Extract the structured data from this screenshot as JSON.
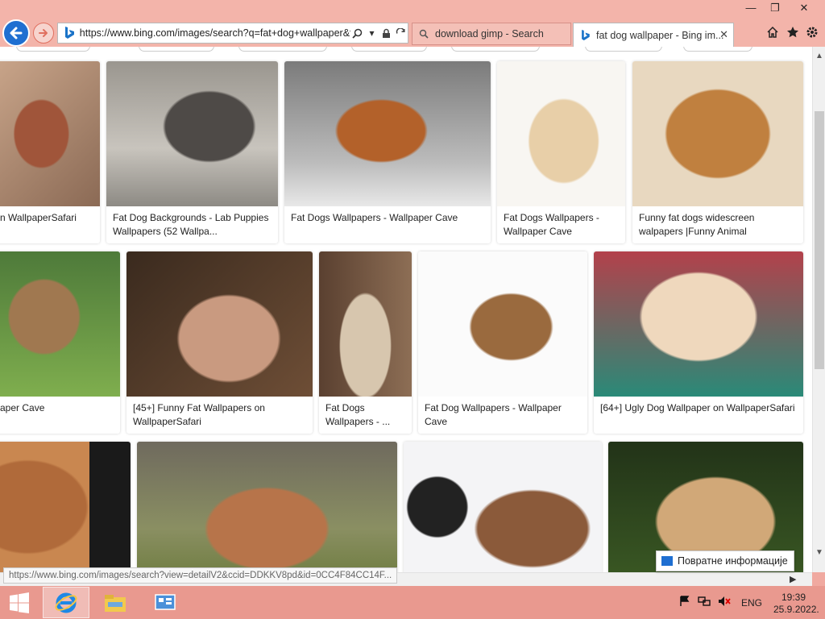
{
  "browser": {
    "url": "https://www.bing.com/images/search?q=fat+dog+wallpaper&f",
    "tabs": [
      {
        "label": "download gimp - Search",
        "active": false
      },
      {
        "label": "fat dog wallpaper - Bing im...",
        "active": true
      }
    ],
    "window_controls": {
      "minimize": "—",
      "restore": "❐",
      "close": "✕"
    }
  },
  "results": [
    {
      "caption": "n WallpaperSafari"
    },
    {
      "caption": "Fat Dog Backgrounds - Lab Puppies Wallpapers (52 Wallpa..."
    },
    {
      "caption": "Fat Dogs Wallpapers - Wallpaper Cave"
    },
    {
      "caption": "Fat Dogs Wallpapers - Wallpaper Cave"
    },
    {
      "caption": "Funny fat dogs widescreen walpapers |Funny Animal"
    },
    {
      "caption": "aper Cave"
    },
    {
      "caption": "[45+] Funny Fat Wallpapers on WallpaperSafari"
    },
    {
      "caption": "Fat Dogs Wallpapers - ..."
    },
    {
      "caption": "Fat Dog Wallpapers - Wallpaper Cave"
    },
    {
      "caption": "[64+] Ugly Dog Wallpaper on WallpaperSafari"
    },
    {
      "caption": ""
    },
    {
      "caption": ""
    },
    {
      "caption": ""
    },
    {
      "caption": ""
    }
  ],
  "status_url": "https://www.bing.com/images/search?view=detailV2&ccid=DDKKV8pd&id=0CC4F84CC14F...",
  "feedback_label": "Повратне информације",
  "taskbar": {
    "language": "ENG",
    "time": "19:39",
    "date": "25.9.2022."
  },
  "colors": {
    "accent": "#1f6fd1",
    "titlebar": "#f3b4aa",
    "taskbar": "#e9998f"
  }
}
